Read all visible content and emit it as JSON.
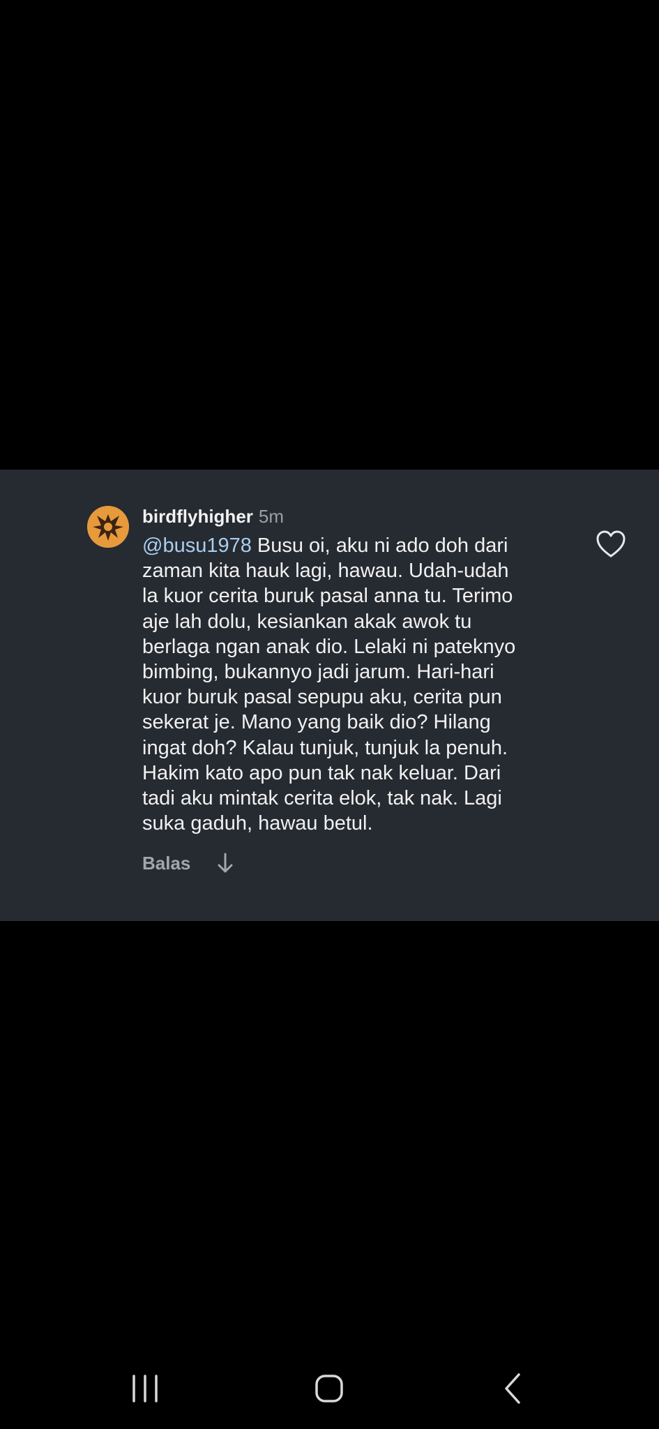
{
  "comment": {
    "username": "birdflyhigher",
    "timestamp": "5m",
    "mention": "@busu1978",
    "text": " Busu oi, aku ni ado doh dari\nzaman kita hauk lagi, hawau. Udah-udah\nla kuor cerita buruk pasal anna tu. Terimo\naje lah dolu, kesiankan akak awok tu\nberlaga ngan anak dio. Lelaki ni pateknyo\nbimbing, bukannyo jadi jarum. Hari-hari\nkuor buruk pasal sepupu aku, cerita pun\nsekerat je. Mano yang baik dio? Hilang\ningat doh? Kalau tunjuk, tunjuk la penuh.\nHakim kato apo pun tak nak keluar. Dari\ntadi aku mintak cerita elok, tak nak. Lagi\nsuka gaduh, hawau betul.",
    "reply_label": "Balas",
    "like_icon": "heart-outline-icon",
    "expand_icon": "arrow-down-icon"
  },
  "nav": {
    "recent_icon": "recent-apps-icon",
    "home_icon": "home-icon",
    "back_icon": "back-icon"
  },
  "colors": {
    "background": "#000000",
    "card": "#262a31",
    "mention": "#a9ceef",
    "avatar": "#e79a3b"
  }
}
